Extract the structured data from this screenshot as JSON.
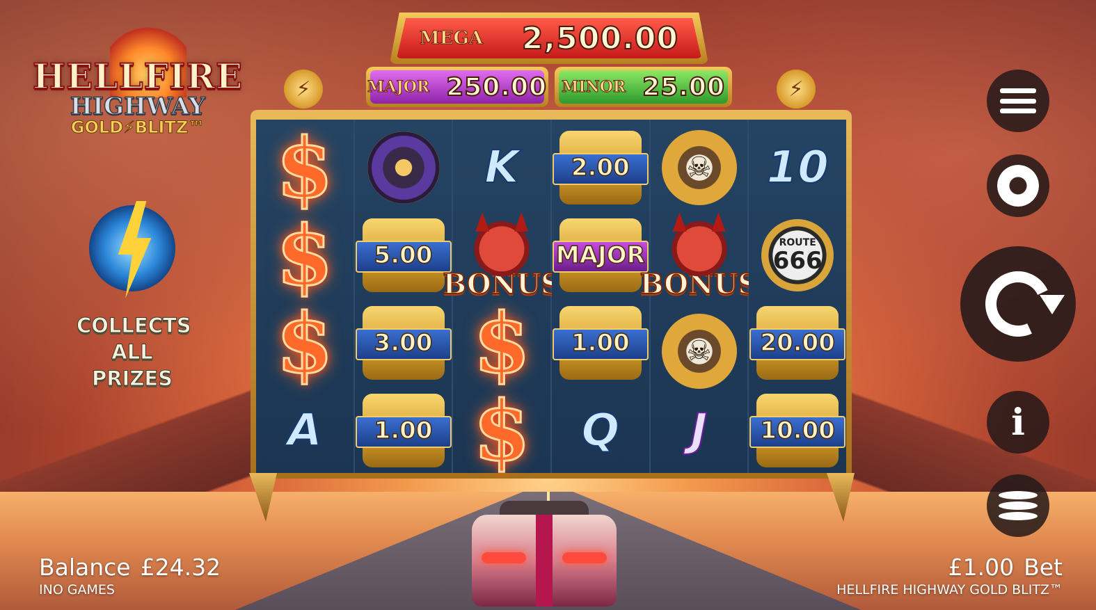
{
  "logo": {
    "line1": "HELLFIRE",
    "line2": "HIGHWAY",
    "line3": "GOLD⚡BLITZ™"
  },
  "collect": {
    "text_line1": "COLLECTS",
    "text_line2": "ALL PRIZES"
  },
  "jackpots": {
    "mega": {
      "label": "MEGA",
      "value": "2,500.00"
    },
    "major": {
      "label": "MAJOR",
      "value": "250.00"
    },
    "minor": {
      "label": "MINOR",
      "value": "25.00"
    }
  },
  "reels": {
    "r1": [
      "$",
      "$",
      "$",
      "A"
    ],
    "r2": {
      "row1_icon": "tyre-icon",
      "row2": "5.00",
      "row3": "3.00",
      "row4": "1.00"
    },
    "r3": {
      "row1": "K",
      "bonus": "BONUS",
      "row3": "$",
      "row4": "$"
    },
    "r4": {
      "row1": "2.00",
      "row2": "MAJOR",
      "row3": "1.00",
      "row4": "Q"
    },
    "r5": {
      "row1_icon": "skull-pistons-icon",
      "bonus": "BONUS",
      "row3_icon": "skull-pistons-icon",
      "row4": "J"
    },
    "r6": {
      "row1": "10",
      "route_top": "ROUTE",
      "route_num": "666",
      "row3": "20.00",
      "row4": "10.00"
    }
  },
  "controls": {
    "menu": "menu-icon",
    "settings": "gear-icon",
    "spin": "spin-icon",
    "info": "i",
    "bet": "coins-icon"
  },
  "footer": {
    "balance_label": "Balance",
    "balance_value": "£24.32",
    "provider": "INO GAMES",
    "bet_value": "£1.00",
    "bet_label": "Bet",
    "game_name": "HELLFIRE HIGHWAY GOLD BLITZ™"
  },
  "colors": {
    "mega": "#c61b1b",
    "major": "#8e23a8",
    "minor": "#2c9a2c",
    "frame": "#d29b2a"
  }
}
